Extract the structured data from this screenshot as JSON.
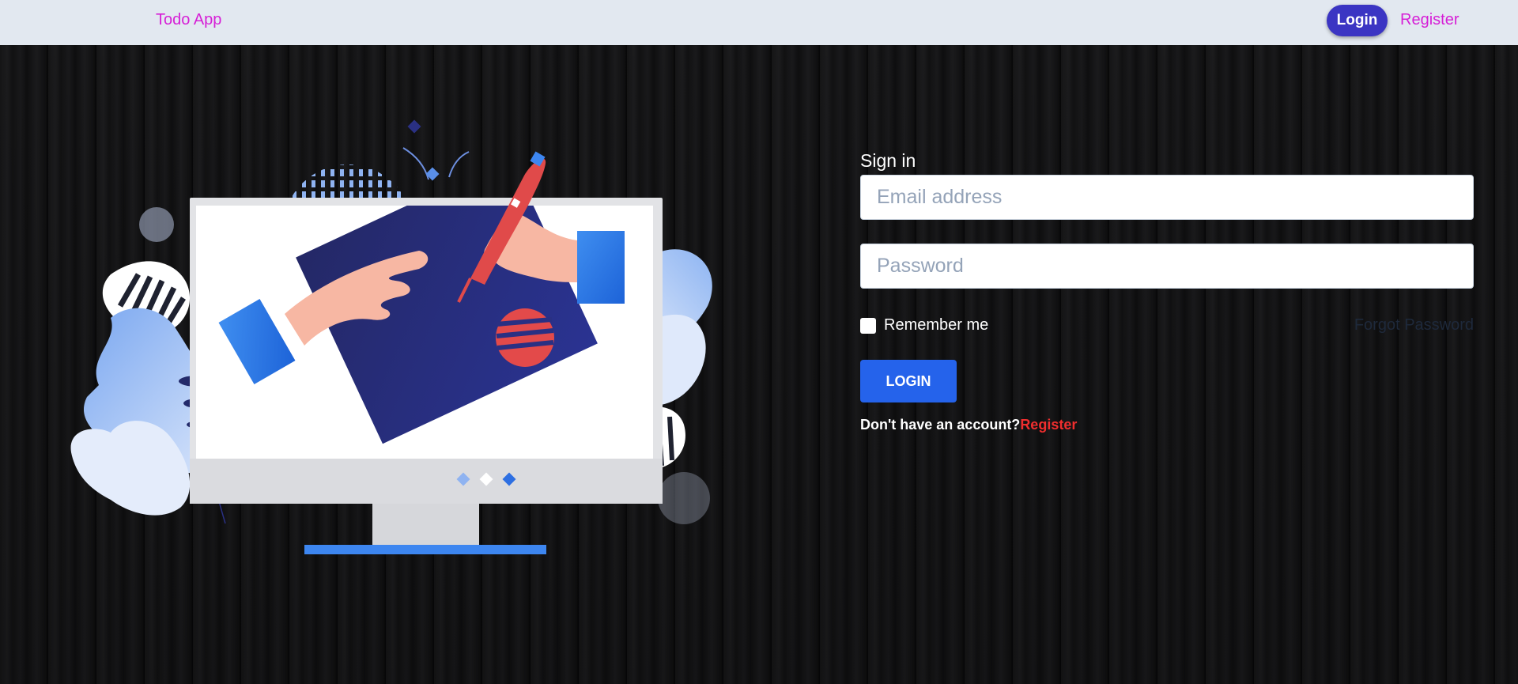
{
  "navbar": {
    "brand": "Todo App",
    "login_label": "Login",
    "register_label": "Register"
  },
  "form": {
    "title": "Sign in",
    "email_placeholder": "Email address",
    "password_placeholder": "Password",
    "remember_label": "Remember me",
    "forgot_label": "Forgot Password",
    "login_button": "LOGIN",
    "signup_prompt": "Don't have an account?",
    "signup_link": "Register"
  },
  "colors": {
    "navbar_bg": "#e2e8f0",
    "brand_pink": "#d61fd6",
    "nav_login_bg": "#3b35c3",
    "primary_blue": "#2563eb",
    "register_red": "#ef2e2e"
  }
}
